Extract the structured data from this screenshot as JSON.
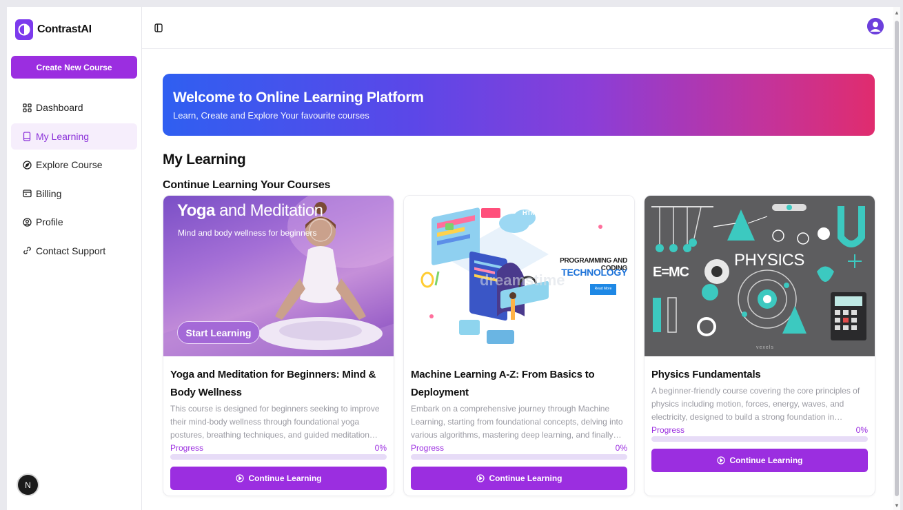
{
  "app": {
    "name": "ContrastAI"
  },
  "sidebar": {
    "create_label": "Create New Course",
    "items": [
      {
        "label": "Dashboard",
        "icon": "grid-icon",
        "active": false
      },
      {
        "label": "My Learning",
        "icon": "book-icon",
        "active": true
      },
      {
        "label": "Explore Course",
        "icon": "compass-icon",
        "active": false
      },
      {
        "label": "Billing",
        "icon": "wallet-icon",
        "active": false
      },
      {
        "label": "Profile",
        "icon": "user-circle-icon",
        "active": false
      },
      {
        "label": "Contact Support",
        "icon": "link-icon",
        "active": false
      }
    ],
    "badge": "N"
  },
  "banner": {
    "title": "Welcome to Online Learning Platform",
    "subtitle": "Learn, Create and Explore Your favourite courses"
  },
  "page": {
    "title": "My Learning",
    "section_title": "Continue Learning Your Courses"
  },
  "courses": [
    {
      "title": "Yoga and Meditation for Beginners: Mind & Body Wellness",
      "description": "This course is designed for beginners seeking to improve their mind-body wellness through foundational yoga postures, breathing techniques, and guided meditation practices. Learn to...",
      "progress_label": "Progress",
      "progress_value": "0%",
      "button_label": "Continue Learning",
      "image": {
        "headline_a": "Yoga",
        "headline_b": "and Meditation",
        "tagline": "Mind and body wellness for beginners",
        "cta": "Start Learning"
      }
    },
    {
      "title": "Machine Learning A-Z: From Basics to Deployment",
      "description": "Embark on a comprehensive journey through Machine Learning, starting from foundational concepts, delving into various algorithms, mastering deep learning, and finally learning to depl...",
      "progress_label": "Progress",
      "progress_value": "0%",
      "button_label": "Continue Learning",
      "image": {
        "line1": "PROGRAMMING AND CODING",
        "line2": "TECHNOLOGY",
        "button": "Read More",
        "html_tag": "HTML",
        "watermark": "dreamstime"
      }
    },
    {
      "title": "Physics Fundamentals",
      "description": "A beginner-friendly course covering the core principles of physics including motion, forces, energy, waves, and electricity, designed to build a strong foundation in scientific understanding.",
      "progress_label": "Progress",
      "progress_value": "0%",
      "button_label": "Continue Learning",
      "image": {
        "headline": "PHYSICS",
        "formula": "E=MC",
        "credit": "vexels"
      }
    }
  ],
  "colors": {
    "accent": "#9b2ee0",
    "banner_start": "#2f5ff1",
    "banner_end": "#e02c6e",
    "active_bg": "#f6eefc"
  }
}
